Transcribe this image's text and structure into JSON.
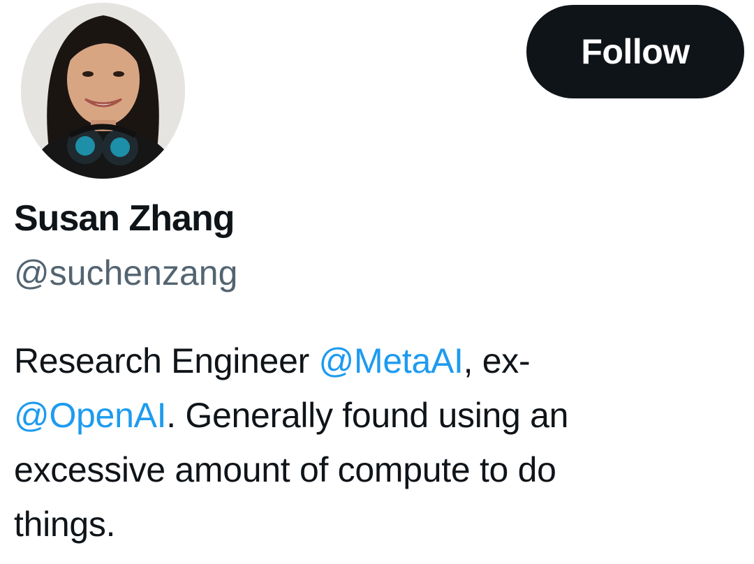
{
  "profile": {
    "avatar_icon": "profile-photo",
    "display_name": "Susan Zhang",
    "handle": "@suchenzang",
    "follow_label": "Follow",
    "bio": {
      "line1_text": "Research Engineer ",
      "mention_meta": "@MetaAI",
      "line1_suffix": ", ex-",
      "mention_openai": "@OpenAI",
      "line2_suffix": ". Generally found using an",
      "line3": "excessive amount of compute to do",
      "line4": "things."
    }
  },
  "colors": {
    "text": "#0f1419",
    "secondary_text": "#536471",
    "link": "#1d9bf0",
    "button_bg": "#0f1419",
    "button_text": "#ffffff",
    "background": "#ffffff"
  }
}
